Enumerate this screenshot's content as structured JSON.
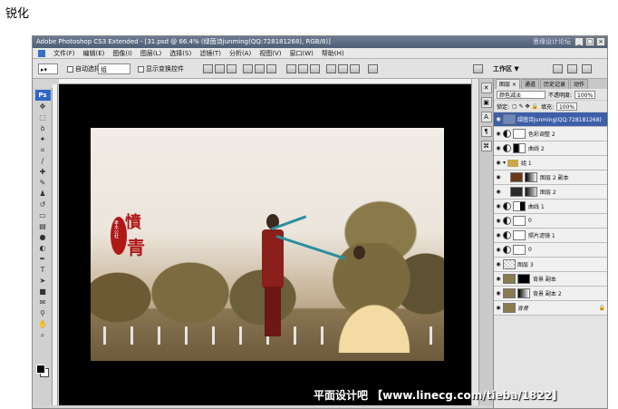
{
  "heading": "锐化",
  "window": {
    "title": "Adobe Photoshop CS3 Extended - [31.psd @ 66.4% (绿茵诗junming(QQ:728181268), RGB/8)]",
    "top_watermark": "思缘设计论坛",
    "buttons": [
      "_",
      "□",
      "×"
    ]
  },
  "menu": [
    "文件(F)",
    "编辑(E)",
    "图像(I)",
    "图层(L)",
    "选择(S)",
    "滤镜(T)",
    "分析(A)",
    "视图(V)",
    "窗口(W)",
    "帮助(H)"
  ],
  "options": {
    "auto_select": "自动选择:",
    "auto_select_value": "组",
    "show_transform": "显示变换控件",
    "workspace": "工作区 ▼"
  },
  "toolbox": {
    "badge": "Ps",
    "tools": [
      "move-tool",
      "marquee-tool",
      "lasso-tool",
      "magic-wand-tool",
      "crop-tool",
      "slice-tool",
      "healing-tool",
      "brush-tool",
      "stamp-tool",
      "history-brush-tool",
      "eraser-tool",
      "gradient-tool",
      "blur-tool",
      "dodge-tool",
      "pen-tool",
      "type-tool",
      "path-select-tool",
      "shape-tool",
      "notes-tool",
      "eyedropper-tool",
      "hand-tool",
      "zoom-tool"
    ]
  },
  "seal": {
    "w1": "憤",
    "w2": "青",
    "small": "孝木公社"
  },
  "panel": {
    "tabs": [
      "图层 ×",
      "通道",
      "历史记录",
      "动作"
    ],
    "blend_mode": "颜色减淡",
    "opacity_label": "不透明度:",
    "opacity_value": "100%",
    "lock_label": "锁定:",
    "fill_label": "填充:",
    "fill_value": "100%",
    "layers": [
      {
        "name": "绿茵诗junming(QQ:728181268)",
        "type": "plain"
      },
      {
        "name": "色彩调整 2",
        "type": "adj"
      },
      {
        "name": "曲线 2",
        "type": "adj"
      },
      {
        "name": "组 1",
        "type": "group"
      },
      {
        "name": "图层 2 副本",
        "type": "plain"
      },
      {
        "name": "图层 2",
        "type": "plain"
      },
      {
        "name": "曲线 1",
        "type": "adj"
      },
      {
        "name": "0",
        "type": "adj"
      },
      {
        "name": "照片滤镜 1",
        "type": "adj"
      },
      {
        "name": "0",
        "type": "adj"
      },
      {
        "name": "图层 3",
        "type": "plain"
      },
      {
        "name": "背景 副本",
        "type": "plain"
      },
      {
        "name": "背景 副本 2",
        "type": "plain"
      },
      {
        "name": "背景",
        "type": "plain"
      }
    ]
  },
  "footer_watermark": "平面设计吧  【www.linecg.com/tieba/1822】"
}
